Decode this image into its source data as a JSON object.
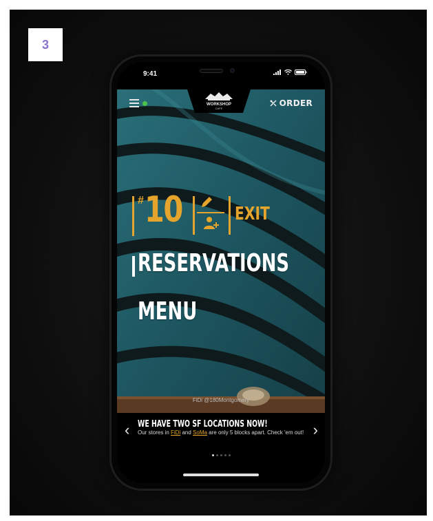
{
  "step": {
    "number": "3"
  },
  "status_bar": {
    "time": "9:41"
  },
  "nav": {
    "logo_text": "WORKSHOP",
    "logo_subtext": "CAFE",
    "order_label": "ORDER",
    "online_status_color": "#4cc24a"
  },
  "seat": {
    "hash": "#",
    "table_number": "10",
    "exit_label": "EXIT"
  },
  "menu_items": {
    "reservations": "RESERVATIONS",
    "menu": "MENU"
  },
  "hero": {
    "caption": "FiDi @180Montgomery"
  },
  "promo": {
    "title": "WE HAVE TWO SF LOCATIONS NOW!",
    "body_prefix": "Our stores in ",
    "link_fidi": "FiDi",
    "body_middle": " and ",
    "link_soma": "SoMa",
    "body_suffix": " are only 5 blocks apart. Check 'em out!",
    "active_slide": 1,
    "slide_count": 5
  },
  "colors": {
    "accent": "#e5a42b",
    "hero_base": "#1e4d56",
    "badge_text": "#8a74c9"
  }
}
